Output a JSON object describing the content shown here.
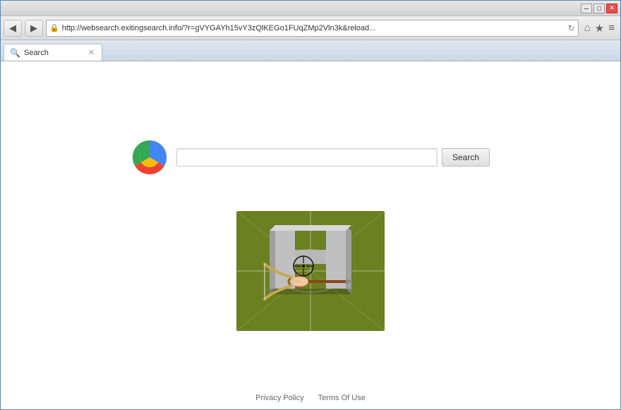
{
  "window": {
    "title": "Search",
    "controls": {
      "minimize": "─",
      "maximize": "□",
      "close": "✕"
    }
  },
  "browser": {
    "back_label": "◀",
    "forward_label": "▶",
    "address": "http://websearch.exitingsearch.info/?r=gVYGAYh15vY3zQlKEGo1FUqZMp2Vln3k&reload...",
    "refresh_label": "↻",
    "tab_title": "Search",
    "tab_favicon": "🔍",
    "home_label": "⌂",
    "bookmark_label": "★",
    "menu_label": "≡"
  },
  "search": {
    "input_placeholder": "",
    "input_value": "",
    "button_label": "Search"
  },
  "footer": {
    "privacy_label": "Privacy Policy",
    "terms_label": "Terms Of Use"
  },
  "colors": {
    "search_button_bg": "#f0f0f0",
    "game_green": "#6b7a2a",
    "game_light_green": "#8a9a30"
  }
}
